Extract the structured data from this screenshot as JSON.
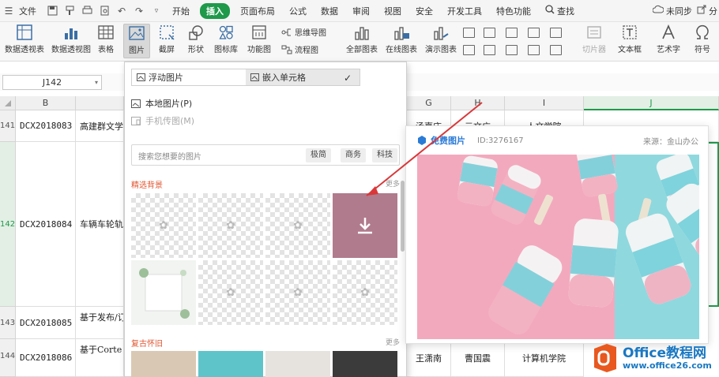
{
  "menubar": {
    "file": "文件",
    "tabs": [
      "开始",
      "插入",
      "页面布局",
      "公式",
      "数据",
      "审阅",
      "视图",
      "安全",
      "开发工具",
      "特色功能"
    ],
    "active_tab": "插入",
    "search": "查找",
    "sync": "未同步",
    "share": "分"
  },
  "ribbon": {
    "pivot_table": "数据透视表",
    "pivot_chart": "数据透视图",
    "table": "表格",
    "picture": "图片",
    "screenshot": "截屏",
    "shapes": "形状",
    "icon_lib": "图标库",
    "func_chart": "功能图",
    "mindmap": "思维导图",
    "flowchart": "流程图",
    "all_charts": "全部图表",
    "online_charts": "在线图表",
    "demo_charts": "演示图表",
    "slicer": "切片器",
    "textbox": "文本框",
    "wordart": "艺术字",
    "symbol": "符号"
  },
  "namebox": "J142",
  "sheet": {
    "columns": [
      "B",
      "G",
      "H",
      "I",
      "J"
    ],
    "row_numbers": [
      "141",
      "142",
      "143",
      "144"
    ],
    "rows": [
      {
        "id": "DCX2018083",
        "title": "高建群文学",
        "g": "汤嘉庆",
        "h": "元文广",
        "i": "人文学院"
      },
      {
        "id": "DCX2018084",
        "title": "车辆车轮轨",
        "g": "",
        "h": "",
        "i": ""
      },
      {
        "id": "DCX2018085",
        "title": "基于发布/订",
        "g": "",
        "h": "",
        "i": ""
      },
      {
        "id": "DCX2018086",
        "title": "基于Corte",
        "g": "王潇南",
        "h": "曹国震",
        "i": "计算机学院"
      }
    ]
  },
  "panel": {
    "float_picture": "浮动图片",
    "embed_cell": "嵌入单元格",
    "local_picture": "本地图片(P)",
    "phone_picture": "手机传图(M)",
    "search_placeholder": "搜索您想要的图片",
    "tags": [
      "极简",
      "商务",
      "科技"
    ],
    "section1": "精选背景",
    "section2": "复古怀旧",
    "more": "更多"
  },
  "preview": {
    "label": "免费图片",
    "id": "ID:3276167",
    "source": "来源：金山办公"
  },
  "watermark": {
    "brand": "Office教程网",
    "url": "www.office26.com"
  },
  "colors": {
    "accent": "#1e9a4a",
    "section": "#e05530",
    "pink": "#f2a9be",
    "teal": "#8fd8de",
    "arrow": "#d9383a"
  }
}
